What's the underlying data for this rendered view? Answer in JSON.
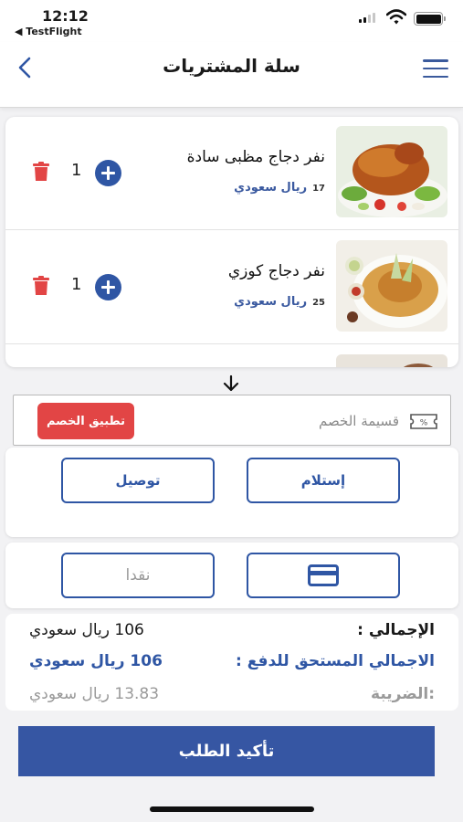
{
  "status_bar": {
    "time": "12:12",
    "back_app": "◀ TestFlight"
  },
  "header": {
    "title": "سلة المشتريات"
  },
  "cart_items": [
    {
      "name": "نفر دجاج مظبى سادة",
      "price": "17",
      "currency": "ريال سعودي",
      "quantity": "1"
    },
    {
      "name": "نفر دجاج كوزي",
      "price": "25",
      "currency": "ريال سعودي",
      "quantity": "1"
    }
  ],
  "coupon": {
    "placeholder": "قسيمة الخصم",
    "apply_label": "تطبيق الخصم"
  },
  "delivery": {
    "pickup_label": "إستلام",
    "delivery_label": "توصيل"
  },
  "payment": {
    "cash_label": "نقدا"
  },
  "totals": {
    "total_label": "الإجمالي :",
    "total_value": "106 ريال سعودي",
    "due_label": "الاجمالي المستحق للدفع :",
    "due_value": "106 ريال سعودي",
    "tax_label": ":الضريبة",
    "tax_value": "13.83 ريال سعودي"
  },
  "confirm_label": "تأكيد الطلب",
  "colors": {
    "primary": "#2f56a4",
    "danger": "#e24545",
    "confirm": "#3656a3"
  }
}
